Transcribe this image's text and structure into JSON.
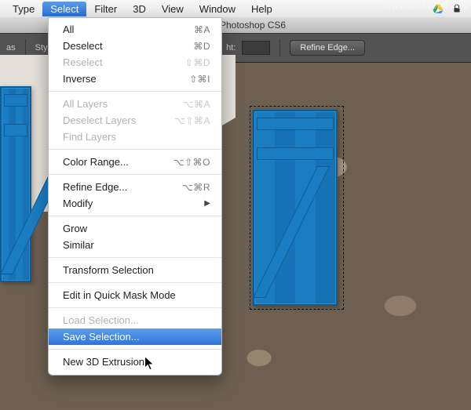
{
  "menubar": {
    "items": [
      "Type",
      "Select",
      "Filter",
      "3D",
      "View",
      "Window",
      "Help"
    ],
    "active_index": 1
  },
  "window": {
    "title": "Photoshop CS6"
  },
  "options_bar": {
    "side_label": "as",
    "style_label": "Style:",
    "height_label": "ht:",
    "height_value": "",
    "refine_edge_label": "Refine Edge..."
  },
  "dropdown": {
    "sections": [
      [
        {
          "label": "All",
          "shortcut": "⌘A",
          "enabled": true
        },
        {
          "label": "Deselect",
          "shortcut": "⌘D",
          "enabled": true
        },
        {
          "label": "Reselect",
          "shortcut": "⇧⌘D",
          "enabled": false
        },
        {
          "label": "Inverse",
          "shortcut": "⇧⌘I",
          "enabled": true
        }
      ],
      [
        {
          "label": "All Layers",
          "shortcut": "⌥⌘A",
          "enabled": false
        },
        {
          "label": "Deselect Layers",
          "shortcut": "⌥⇧⌘A",
          "enabled": false
        },
        {
          "label": "Find Layers",
          "shortcut": "",
          "enabled": false
        }
      ],
      [
        {
          "label": "Color Range...",
          "shortcut": "⌥⇧⌘O",
          "enabled": true
        }
      ],
      [
        {
          "label": "Refine Edge...",
          "shortcut": "⌥⌘R",
          "enabled": true
        },
        {
          "label": "Modify",
          "shortcut": "",
          "enabled": true,
          "submenu": true
        }
      ],
      [
        {
          "label": "Grow",
          "shortcut": "",
          "enabled": true
        },
        {
          "label": "Similar",
          "shortcut": "",
          "enabled": true
        }
      ],
      [
        {
          "label": "Transform Selection",
          "shortcut": "",
          "enabled": true
        }
      ],
      [
        {
          "label": "Edit in Quick Mask Mode",
          "shortcut": "",
          "enabled": true
        }
      ],
      [
        {
          "label": "Load Selection...",
          "shortcut": "",
          "enabled": false
        },
        {
          "label": "Save Selection...",
          "shortcut": "",
          "enabled": true,
          "highlight": true
        }
      ],
      [
        {
          "label": "New 3D Extrusion",
          "shortcut": "",
          "enabled": true
        }
      ]
    ]
  },
  "watermark": "WWW.MISSYUAN.COM"
}
